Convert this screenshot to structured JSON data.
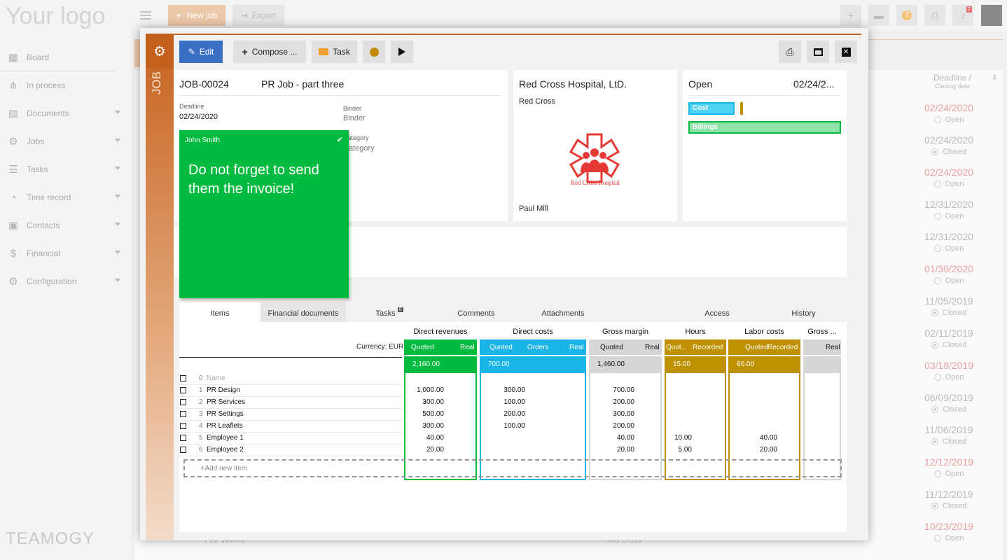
{
  "app": {
    "logo": "Your logo",
    "brand_footer": "TEAMOGY"
  },
  "sidebar": {
    "items": [
      {
        "label": "Board",
        "icon": "grid-icon",
        "caret": false
      },
      {
        "label": "In process",
        "icon": "process-icon",
        "caret": false
      },
      {
        "label": "Documents",
        "icon": "document-icon",
        "caret": true
      },
      {
        "label": "Jobs",
        "icon": "jobs-icon",
        "caret": true
      },
      {
        "label": "Tasks",
        "icon": "tasks-icon",
        "caret": true
      },
      {
        "label": "Time record",
        "icon": "clock-icon",
        "caret": true
      },
      {
        "label": "Contacts",
        "icon": "contact-icon",
        "caret": true
      },
      {
        "label": "Financial",
        "icon": "dollar-icon",
        "caret": true
      },
      {
        "label": "Configuration",
        "icon": "gear-icon",
        "caret": true
      }
    ]
  },
  "topbar": {
    "new_job": "New job",
    "export": "Export",
    "notification_count": "7"
  },
  "background_list": {
    "header": "Deadline /",
    "header_sub": "Closing date",
    "footer_left": "Petr Veverá",
    "footer_right": "Red Cross",
    "rows": [
      {
        "date": "02/24/2020",
        "status": "Open",
        "red": true,
        "closed": false
      },
      {
        "date": "02/24/2020",
        "status": "Closed",
        "red": false,
        "closed": true
      },
      {
        "date": "02/24/2020",
        "status": "Open",
        "red": true,
        "closed": false
      },
      {
        "date": "12/31/2020",
        "status": "Open",
        "red": false,
        "closed": false
      },
      {
        "date": "12/31/2020",
        "status": "Open",
        "red": false,
        "closed": false
      },
      {
        "date": "01/30/2020",
        "status": "Open",
        "red": true,
        "closed": false
      },
      {
        "date": "11/05/2019",
        "status": "Closed",
        "red": false,
        "closed": true
      },
      {
        "date": "02/11/2019",
        "status": "Closed",
        "red": false,
        "closed": true
      },
      {
        "date": "03/18/2019",
        "status": "Open",
        "red": true,
        "closed": false
      },
      {
        "date": "06/09/2019",
        "status": "Closed",
        "red": false,
        "closed": true
      },
      {
        "date": "11/06/2019",
        "status": "Closed",
        "red": false,
        "closed": true
      },
      {
        "date": "12/12/2019",
        "status": "Open",
        "red": true,
        "closed": false
      },
      {
        "date": "11/12/2019",
        "status": "Closed",
        "red": false,
        "closed": true
      },
      {
        "date": "10/23/2019",
        "status": "Open",
        "red": true,
        "closed": false
      }
    ]
  },
  "modal": {
    "side_label": "JOB",
    "toolbar": {
      "edit": "Edit",
      "compose": "Compose ...",
      "task": "Task"
    },
    "job": {
      "number": "JOB-00024",
      "title": "PR Job - part three",
      "deadline_label": "Deadline",
      "deadline": "02/24/2020",
      "binder_label": "Binder",
      "binder": "Binder",
      "category_label": "Category",
      "category": "Category"
    },
    "client": {
      "name": "Red Cross Hospital, LtD.",
      "short": "Red Cross",
      "logo_text": "Red Cross Hospital",
      "contact": "Paul Mill"
    },
    "status": {
      "state": "Open",
      "date": "02/24/2...",
      "cost_label": "Cost",
      "billings_label": "Billings"
    },
    "note": {
      "author": "John Smith",
      "text": "Do not forget to send them the invoice!"
    },
    "tabs": [
      {
        "label": "Items",
        "active": true
      },
      {
        "label": "Financial documents",
        "active": false
      },
      {
        "label": "Tasks",
        "badge": "0",
        "active": false
      },
      {
        "label": "Comments",
        "active": false
      },
      {
        "label": "Attachments",
        "active": false
      },
      {
        "label": "Access",
        "active": false
      },
      {
        "label": "History",
        "active": false
      }
    ],
    "items": {
      "currency": "Currency: EUR",
      "add_new": "Add new item",
      "name_placeholder": "Name",
      "sections": [
        {
          "title": "Direct revenues",
          "color": "#00bb3f",
          "sub": [
            "Quoted",
            "Real"
          ],
          "total": "2,160.00"
        },
        {
          "title": "Direct costs",
          "color": "#1ab5e8",
          "sub": [
            "Quoted",
            "Orders",
            "Real"
          ],
          "total": "700.00"
        },
        {
          "title": "Gross margin",
          "color": "#d6d6d6",
          "sub": [
            "Quoted",
            "Real"
          ],
          "total": "1,460.00"
        },
        {
          "title": "Hours",
          "color": "#bf9000",
          "sub": [
            "Quot...",
            "Recorded"
          ],
          "total": "15.00"
        },
        {
          "title": "Labor costs",
          "color": "#bf9000",
          "sub": [
            "Quoted",
            "Recorded"
          ],
          "total": "60.00"
        },
        {
          "title": "Gross ...",
          "color": "#d6d6d6",
          "sub": [
            "Real"
          ],
          "total": ""
        }
      ],
      "rows": [
        {
          "no": "1",
          "name": "PR Design",
          "rev": "1,000.00",
          "cost": "300.00",
          "gm": "700.00",
          "hours": "",
          "labor": ""
        },
        {
          "no": "2",
          "name": "PR Services",
          "rev": "300.00",
          "cost": "100.00",
          "gm": "200.00",
          "hours": "",
          "labor": ""
        },
        {
          "no": "3",
          "name": "PR Settings",
          "rev": "500.00",
          "cost": "200.00",
          "gm": "300.00",
          "hours": "",
          "labor": ""
        },
        {
          "no": "4",
          "name": "PR Leaflets",
          "rev": "300.00",
          "cost": "100.00",
          "gm": "200.00",
          "hours": "",
          "labor": ""
        },
        {
          "no": "5",
          "name": "Employee 1",
          "rev": "40.00",
          "cost": "",
          "gm": "40.00",
          "hours": "10.00",
          "labor": "40.00"
        },
        {
          "no": "6",
          "name": "Employee 2",
          "rev": "20.00",
          "cost": "",
          "gm": "20.00",
          "hours": "5.00",
          "labor": "20.00"
        }
      ]
    }
  }
}
